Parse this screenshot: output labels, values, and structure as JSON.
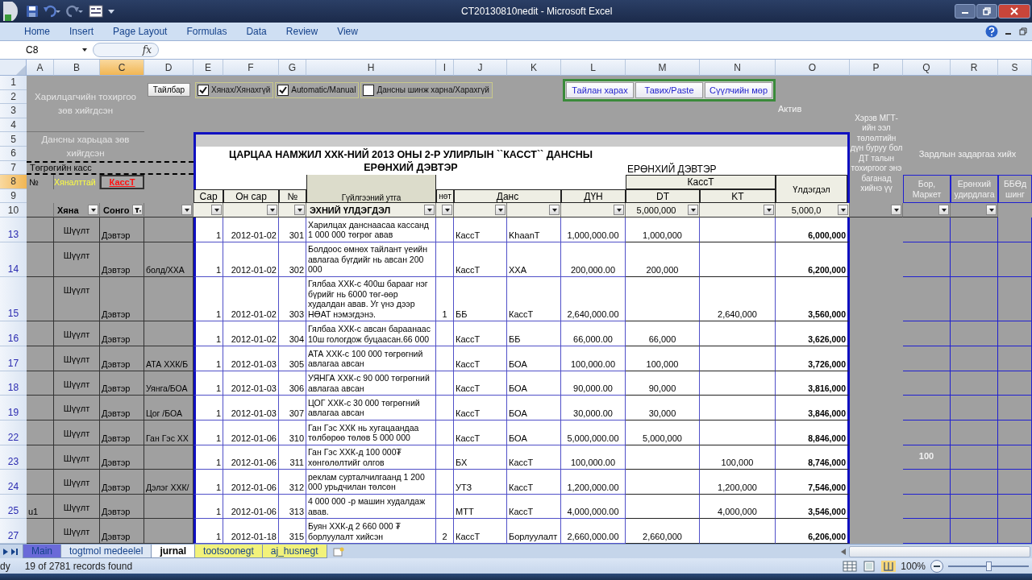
{
  "window": {
    "title": "CT20130810nedit - Microsoft Excel"
  },
  "ribbon_tabs": [
    "Home",
    "Insert",
    "Page Layout",
    "Formulas",
    "Data",
    "Review",
    "View"
  ],
  "formula_bar": {
    "name_box": "C8",
    "function_label": "fx"
  },
  "columns": [
    {
      "label": "A",
      "selected": false
    },
    {
      "label": "B",
      "selected": false
    },
    {
      "label": "C",
      "selected": true
    },
    {
      "label": "D",
      "selected": false
    },
    {
      "label": "E",
      "selected": false
    },
    {
      "label": "F",
      "selected": false
    },
    {
      "label": "G",
      "selected": false
    },
    {
      "label": "H",
      "selected": false
    },
    {
      "label": "I",
      "selected": false
    },
    {
      "label": "J",
      "selected": false
    },
    {
      "label": "K",
      "selected": false
    },
    {
      "label": "L",
      "selected": false
    },
    {
      "label": "M",
      "selected": false
    },
    {
      "label": "N",
      "selected": false
    },
    {
      "label": "O",
      "selected": false
    },
    {
      "label": "P",
      "selected": false
    },
    {
      "label": "Q",
      "selected": false
    },
    {
      "label": "R",
      "selected": false
    },
    {
      "label": "S",
      "selected": false
    }
  ],
  "header_rows": [
    {
      "label": "1",
      "selected": false
    },
    {
      "label": "2",
      "selected": false
    },
    {
      "label": "3",
      "selected": false
    },
    {
      "label": "4",
      "selected": false
    },
    {
      "label": "5",
      "selected": false
    },
    {
      "label": "6",
      "selected": false
    },
    {
      "label": "7",
      "selected": false
    },
    {
      "label": "8",
      "selected": true
    },
    {
      "label": "9",
      "selected": false
    },
    {
      "label": "10",
      "selected": false
    }
  ],
  "panel": {
    "customer_status": "Харилцагчийн тохиргоо зөв хийгдсэн",
    "account_status": "Дансны харьцаа зөв хийгдсэн",
    "cash_label": "Төгрөгийн касс",
    "number_label": "№",
    "control_label": "Хяналттай",
    "account_label": "КассТ",
    "filter_b": "Хяна",
    "filter_c": "Сонго"
  },
  "help_button": "Тайлбар",
  "checkboxes": [
    {
      "label": "Хянах/Хянахгүй",
      "checked": true
    },
    {
      "label": "Automatic/Manual",
      "checked": true
    },
    {
      "label": "Дансны шинж харна/Харахгүй",
      "checked": false
    }
  ],
  "action_buttons": [
    "Тайлан харах",
    "Тавих/Paste",
    "Сүүлчийн мөр"
  ],
  "asset_label": "Актив",
  "ledger": {
    "title_lines": [
      "ЦАРЦАА НАМЖИЛ ХХК-НИЙ 2013 ОНЫ 2-Р УЛИРЛЫН ``КАССТ`` ДАНСНЫ",
      "ЕРӨНХИЙ ДЭВТЭР"
    ],
    "subtitle": "ЕРӨНХИЙ ДЭВТЭР",
    "account_group": "КассТ",
    "balance_heading": "Үлдэгдэл",
    "headings": [
      "Сар",
      "Он сар",
      "№",
      "Гүйлгээний утга",
      "нөт",
      "Данс",
      "ДҮН",
      "DT",
      "KT"
    ],
    "opening_label": "ЭХНИЙ ҮЛДЭГДЭЛ",
    "opening_dt": "5,000,000",
    "opening_balance": "5,000,0"
  },
  "note": "Хэрэв МГТ-ийн ээл төлөлтийн дүн буруу бол ДТ талын тохиргоог энэ баганад хийнэ үү",
  "expense": {
    "title": "Зардлын задаргаа хийх",
    "columns": [
      "Бор, Маркет",
      "Ерөнхий удирдлага",
      "ББӨд шинг"
    ]
  },
  "rows": [
    {
      "row": "13",
      "b": "Шүүлт",
      "c": "Дэвтэр",
      "e": "1",
      "f": "2012-01-02",
      "g": "301",
      "h": "Харилцах данснаасаа кассанд 1 000 000 төгрөг авав",
      "j": "КассТ",
      "k": "KhaanT",
      "l": "1,000,000.00",
      "m": "1,000,000",
      "o": "6,000,000"
    },
    {
      "row": "14",
      "b": "Шүүлт",
      "c": "Дэвтэр",
      "d": "болд/ХХА",
      "e": "1",
      "f": "2012-01-02",
      "g": "302",
      "h": "Болдоос өмнөх тайлант үеийн авлагаа бүгдийг нь авсан 200 000",
      "j": "КассТ",
      "k": "ХХА",
      "l": "200,000.00",
      "m": "200,000",
      "o": "6,200,000"
    },
    {
      "row": "15",
      "b": "Шүүлт",
      "c": "Дэвтэр",
      "e": "1",
      "f": "2012-01-02",
      "g": "303",
      "h": "Гялбаа ХХК-с 400ш барааг нэг бүрийг нь 6000 төг-өөр худалдан авав. Уг үнэ дээр НӨАТ нэмэгдэнэ.",
      "i": "1",
      "j": "ББ",
      "k": "КассТ",
      "l": "2,640,000.00",
      "n": "2,640,000",
      "o": "3,560,000"
    },
    {
      "row": "16",
      "b": "Шүүлт",
      "c": "Дэвтэр",
      "e": "1",
      "f": "2012-01-02",
      "g": "304",
      "h": "Гялбаа ХХК-с авсан бараанаас 10ш гологдож буцаасан.66 000",
      "j": "КассТ",
      "k": "ББ",
      "l": "66,000.00",
      "m": "66,000",
      "o": "3,626,000"
    },
    {
      "row": "17",
      "b": "Шүүлт",
      "c": "Дэвтэр",
      "d": "АТА ХХК/Б",
      "e": "1",
      "f": "2012-01-03",
      "g": "305",
      "h": "АТА ХХК-с 100 000 төгрөгний авлагаа авсан",
      "j": "КассТ",
      "k": "БОА",
      "l": "100,000.00",
      "m": "100,000",
      "o": "3,726,000"
    },
    {
      "row": "18",
      "b": "Шүүлт",
      "c": "Дэвтэр",
      "d": "Уянга/БОА",
      "e": "1",
      "f": "2012-01-03",
      "g": "306",
      "h": "УЯНГА ХХК-с 90 000 төгрөгний авлагаа авсан",
      "j": "КассТ",
      "k": "БОА",
      "l": "90,000.00",
      "m": "90,000",
      "o": "3,816,000"
    },
    {
      "row": "19",
      "b": "Шүүлт",
      "c": "Дэвтэр",
      "d": "Цог /БОА",
      "e": "1",
      "f": "2012-01-03",
      "g": "307",
      "h": "ЦОГ ХХК-с 30 000 төгрөгний авлагаа авсан",
      "j": "КассТ",
      "k": "БОА",
      "l": "30,000.00",
      "m": "30,000",
      "o": "3,846,000"
    },
    {
      "row": "22",
      "b": "Шүүлт",
      "c": "Дэвтэр",
      "d": "Ган Гэс ХХ",
      "e": "1",
      "f": "2012-01-06",
      "g": "310",
      "h": "Ган Гэс ХХК нь хугацаандаа төлбөрөө төлөв 5 000 000",
      "j": "КассТ",
      "k": "БОА",
      "l": "5,000,000.00",
      "m": "5,000,000",
      "o": "8,846,000"
    },
    {
      "row": "23",
      "b": "Шүүлт",
      "c": "Дэвтэр",
      "e": "1",
      "f": "2012-01-06",
      "g": "311",
      "h": "Ган Гэс ХХК-д 100 000₮ хөнгөлөлтийг олгов",
      "j": "БХ",
      "k": "КассТ",
      "l": "100,000.00",
      "n": "100,000",
      "o": "8,746,000",
      "q": "100"
    },
    {
      "row": "24",
      "b": "Шүүлт",
      "c": "Дэвтэр",
      "d": "Дэлэг ХХК/",
      "e": "1",
      "f": "2012-01-06",
      "g": "312",
      "h": "реклам сурталчилгаанд 1 200 000 урьдчилан төлсөн",
      "j": "УТЗ",
      "k": "КассТ",
      "l": "1,200,000.00",
      "n": "1,200,000",
      "o": "7,546,000"
    },
    {
      "row": "25",
      "a": "u1",
      "b": "Шүүлт",
      "c": "Дэвтэр",
      "e": "1",
      "f": "2012-01-06",
      "g": "313",
      "h": "4 000 000 -р машин худалдаж авав.",
      "j": "МТТ",
      "k": "КассТ",
      "l": "4,000,000.00",
      "n": "4,000,000",
      "o": "3,546,000"
    },
    {
      "row": "27",
      "b": "Шүүлт",
      "c": "Дэвтэр",
      "e": "1",
      "f": "2012-01-18",
      "g": "315",
      "h": "Буян ХХК-д 2 660 000 ₮ борлуулалт хийсэн",
      "i": "2",
      "j": "КассТ",
      "k": "Борлуулалт",
      "l": "2,660,000.00",
      "m": "2,660,000",
      "o": "6,206,000"
    }
  ],
  "sheet_tabs": [
    {
      "label": "Main",
      "selected": false,
      "color": "#6a6ad8"
    },
    {
      "label": "togtmol medeelel",
      "selected": false
    },
    {
      "label": "jurnal",
      "selected": true
    },
    {
      "label": "tootsoonegt",
      "selected": false,
      "color": "#f2f27a"
    },
    {
      "label": "aj_husnegt",
      "selected": false,
      "color": "#f2f27a"
    }
  ],
  "status_bar": {
    "mode": "dy",
    "records": "19 of 2781 records found",
    "zoom": "100%",
    "zoom_slider": {
      "level": 0.5
    }
  }
}
